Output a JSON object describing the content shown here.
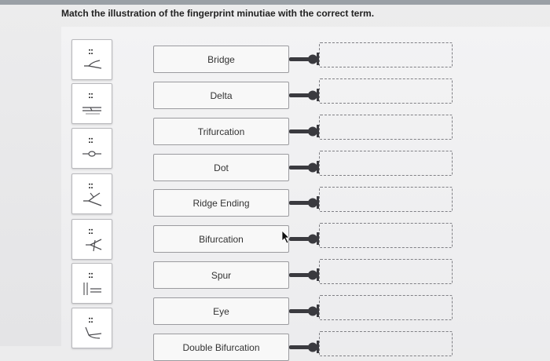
{
  "instruction": "Match the illustration of the fingerprint minutiae with the correct term.",
  "tiles": [
    {
      "icon": "fork-left-icon",
      "grip": "::"
    },
    {
      "icon": "parallel-lines-icon",
      "grip": "::"
    },
    {
      "icon": "loop-line-icon",
      "grip": "::"
    },
    {
      "icon": "branch-icon",
      "grip": "::"
    },
    {
      "icon": "spur-icon",
      "grip": "::"
    },
    {
      "icon": "ridge-lines-icon",
      "grip": "::"
    },
    {
      "icon": "hook-icon",
      "grip": "::"
    }
  ],
  "terms": [
    {
      "label": "Bridge"
    },
    {
      "label": "Delta"
    },
    {
      "label": "Trifurcation"
    },
    {
      "label": "Dot"
    },
    {
      "label": "Ridge Ending"
    },
    {
      "label": "Bifurcation"
    },
    {
      "label": "Spur"
    },
    {
      "label": "Eye"
    },
    {
      "label": "Double Bifurcation"
    }
  ],
  "colors": {
    "connector": "#3a3a3f",
    "border": "#9b9b9f",
    "drop_border": "#7f7f84"
  }
}
